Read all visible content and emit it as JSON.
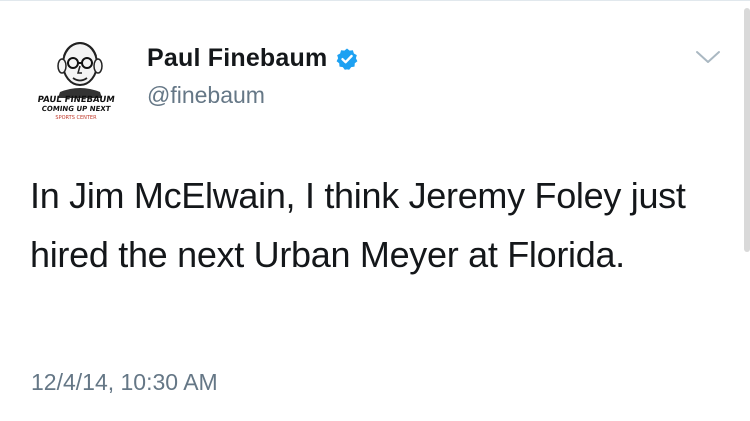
{
  "tweet": {
    "author": {
      "display_name": "Paul Finebaum",
      "handle": "@finebaum",
      "verified": true,
      "avatar": {
        "icon": "caricature-avatar-icon",
        "caption_line1": "PAUL FINEBAUM",
        "caption_line2": "COMING UP NEXT",
        "caption_line3": "SPORTS CENTER"
      }
    },
    "text": "In Jim McElwain, I think Jeremy Foley just hired the next Urban Meyer at Florida.",
    "timestamp": "12/4/14, 10:30 AM"
  },
  "colors": {
    "verified_badge": "#1da1f2",
    "secondary_text": "#657786",
    "primary_text": "#14171a"
  }
}
